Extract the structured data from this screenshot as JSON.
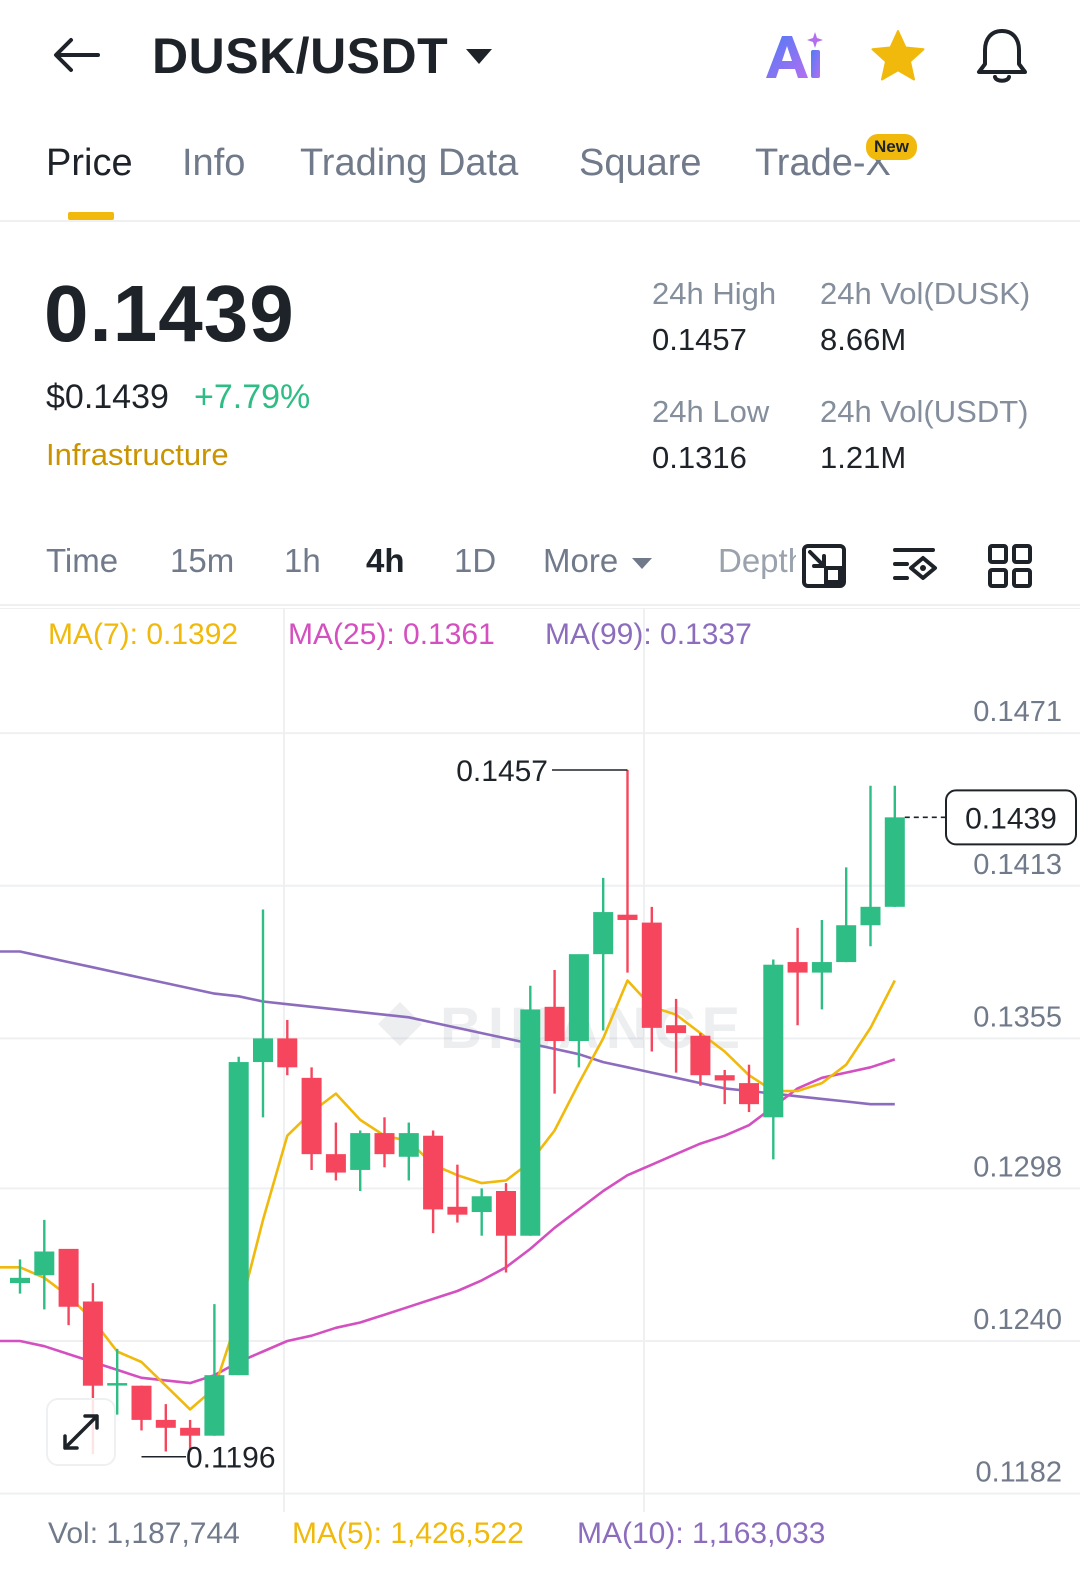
{
  "header": {
    "pair": "DUSK/USDT",
    "icons": [
      "back-arrow-icon",
      "ai-icon",
      "star-icon",
      "bell-icon"
    ]
  },
  "tabs": [
    {
      "label": "Price",
      "active": true
    },
    {
      "label": "Info",
      "active": false
    },
    {
      "label": "Trading Data",
      "active": false
    },
    {
      "label": "Square",
      "active": false
    },
    {
      "label": "Trade-X",
      "active": false,
      "badge": "New"
    }
  ],
  "price": {
    "last": "0.1439",
    "usd": "$0.1439",
    "change": "+7.79%",
    "category": "Infrastructure",
    "stats": {
      "high_label": "24h High",
      "high": "0.1457",
      "low_label": "24h Low",
      "low": "0.1316",
      "vol_base_label": "24h Vol(DUSK)",
      "vol_base": "8.66M",
      "vol_quote_label": "24h Vol(USDT)",
      "vol_quote": "1.21M"
    }
  },
  "intervals": {
    "items": [
      "Time",
      "15m",
      "1h",
      "4h",
      "1D",
      "More"
    ],
    "active": "4h",
    "depth": "Depth",
    "tool_icons": [
      "fullscreen-shrink-icon",
      "indicator-settings-icon",
      "layout-grid-icon"
    ]
  },
  "indicators": {
    "ma7": "MA(7): 0.1392",
    "ma25": "MA(25): 0.1361",
    "ma99": "MA(99): 0.1337",
    "vol": "Vol: 1,187,744",
    "vol_ma5": "MA(5): 1,426,522",
    "vol_ma10": "MA(10): 1,163,033"
  },
  "colors": {
    "up": "#2ebd85",
    "down": "#f6465d",
    "ma7": "#f0b90b",
    "ma25": "#d44fbf",
    "ma99": "#8c6dbd",
    "accent": "#f0b90b"
  },
  "chart_data": {
    "type": "candlestick",
    "y_ticks": [
      "0.1471",
      "0.1413",
      "0.1355",
      "0.1298",
      "0.1240",
      "0.1182"
    ],
    "ylim": [
      0.1175,
      0.1495
    ],
    "current_price": "0.1439",
    "high_marker": "0.1457",
    "low_marker": "0.1196",
    "candles": [
      {
        "o": 0.1262,
        "h": 0.1271,
        "l": 0.1258,
        "c": 0.1264
      },
      {
        "o": 0.1265,
        "h": 0.1286,
        "l": 0.1252,
        "c": 0.1274
      },
      {
        "o": 0.1275,
        "h": 0.1274,
        "l": 0.1246,
        "c": 0.1253
      },
      {
        "o": 0.1255,
        "h": 0.1262,
        "l": 0.1197,
        "c": 0.1223
      },
      {
        "o": 0.1224,
        "h": 0.1237,
        "l": 0.1212,
        "c": 0.1224
      },
      {
        "o": 0.1223,
        "h": 0.1223,
        "l": 0.1206,
        "c": 0.121
      },
      {
        "o": 0.121,
        "h": 0.1216,
        "l": 0.1198,
        "c": 0.1207
      },
      {
        "o": 0.1207,
        "h": 0.121,
        "l": 0.1198,
        "c": 0.1204
      },
      {
        "o": 0.1204,
        "h": 0.1254,
        "l": 0.1204,
        "c": 0.1227
      },
      {
        "o": 0.1227,
        "h": 0.1348,
        "l": 0.1227,
        "c": 0.1346
      },
      {
        "o": 0.1346,
        "h": 0.1404,
        "l": 0.1325,
        "c": 0.1355
      },
      {
        "o": 0.1355,
        "h": 0.1362,
        "l": 0.1341,
        "c": 0.1344
      },
      {
        "o": 0.134,
        "h": 0.1344,
        "l": 0.1305,
        "c": 0.1311
      },
      {
        "o": 0.1311,
        "h": 0.1323,
        "l": 0.1301,
        "c": 0.1304
      },
      {
        "o": 0.1305,
        "h": 0.132,
        "l": 0.1297,
        "c": 0.1319
      },
      {
        "o": 0.1319,
        "h": 0.1325,
        "l": 0.1306,
        "c": 0.1311
      },
      {
        "o": 0.131,
        "h": 0.1323,
        "l": 0.1301,
        "c": 0.1319
      },
      {
        "o": 0.1318,
        "h": 0.132,
        "l": 0.1281,
        "c": 0.129
      },
      {
        "o": 0.1291,
        "h": 0.1307,
        "l": 0.1285,
        "c": 0.1288
      },
      {
        "o": 0.1289,
        "h": 0.1298,
        "l": 0.128,
        "c": 0.1295
      },
      {
        "o": 0.1297,
        "h": 0.13,
        "l": 0.1266,
        "c": 0.128
      },
      {
        "o": 0.128,
        "h": 0.1375,
        "l": 0.128,
        "c": 0.1366
      },
      {
        "o": 0.1367,
        "h": 0.1381,
        "l": 0.1334,
        "c": 0.1354
      },
      {
        "o": 0.1354,
        "h": 0.1386,
        "l": 0.1344,
        "c": 0.1387
      },
      {
        "o": 0.1387,
        "h": 0.1416,
        "l": 0.1358,
        "c": 0.1403
      },
      {
        "o": 0.1402,
        "h": 0.1457,
        "l": 0.138,
        "c": 0.14
      },
      {
        "o": 0.1399,
        "h": 0.1405,
        "l": 0.135,
        "c": 0.1359
      },
      {
        "o": 0.136,
        "h": 0.137,
        "l": 0.1342,
        "c": 0.1357
      },
      {
        "o": 0.1356,
        "h": 0.1357,
        "l": 0.1337,
        "c": 0.1341
      },
      {
        "o": 0.1341,
        "h": 0.1343,
        "l": 0.133,
        "c": 0.1339
      },
      {
        "o": 0.1338,
        "h": 0.1345,
        "l": 0.1327,
        "c": 0.133
      },
      {
        "o": 0.1325,
        "h": 0.1385,
        "l": 0.1309,
        "c": 0.1383
      },
      {
        "o": 0.1384,
        "h": 0.1397,
        "l": 0.136,
        "c": 0.138
      },
      {
        "o": 0.138,
        "h": 0.14,
        "l": 0.1366,
        "c": 0.1384
      },
      {
        "o": 0.1384,
        "h": 0.142,
        "l": 0.1384,
        "c": 0.1398
      },
      {
        "o": 0.1398,
        "h": 0.1451,
        "l": 0.139,
        "c": 0.1405
      },
      {
        "o": 0.1405,
        "h": 0.1451,
        "l": 0.1405,
        "c": 0.1439
      }
    ],
    "ma7": [
      0.1268,
      0.1264,
      0.1257,
      0.1248,
      0.1236,
      0.1232,
      0.1223,
      0.1214,
      0.1222,
      0.125,
      0.1286,
      0.1318,
      0.1327,
      0.1334,
      0.1324,
      0.1318,
      0.1316,
      0.1307,
      0.1303,
      0.13,
      0.1301,
      0.1308,
      0.132,
      0.1338,
      0.1355,
      0.1377,
      0.1367,
      0.1364,
      0.1357,
      0.135,
      0.1341,
      0.1335,
      0.1335,
      0.1338,
      0.1345,
      0.1359,
      0.1377
    ],
    "ma25": [
      0.124,
      0.1238,
      0.1235,
      0.1232,
      0.1229,
      0.1226,
      0.1225,
      0.1224,
      0.1227,
      0.1232,
      0.1236,
      0.124,
      0.1242,
      0.1245,
      0.1247,
      0.125,
      0.1253,
      0.1256,
      0.1259,
      0.1263,
      0.1268,
      0.1275,
      0.1283,
      0.129,
      0.1297,
      0.1303,
      0.1307,
      0.1311,
      0.1315,
      0.1318,
      0.1322,
      0.1329,
      0.1336,
      0.134,
      0.1342,
      0.1344,
      0.1347
    ],
    "ma99": [
      0.1388,
      0.1386,
      0.1384,
      0.1382,
      0.138,
      0.1378,
      0.1376,
      0.1374,
      0.1372,
      0.1371,
      0.1369,
      0.1368,
      0.1367,
      0.1366,
      0.1365,
      0.1364,
      0.1363,
      0.1361,
      0.1359,
      0.1357,
      0.1355,
      0.1353,
      0.1351,
      0.1349,
      0.1346,
      0.1344,
      0.1342,
      0.134,
      0.1338,
      0.1336,
      0.1335,
      0.1334,
      0.1333,
      0.1332,
      0.1331,
      0.133,
      0.133
    ]
  }
}
